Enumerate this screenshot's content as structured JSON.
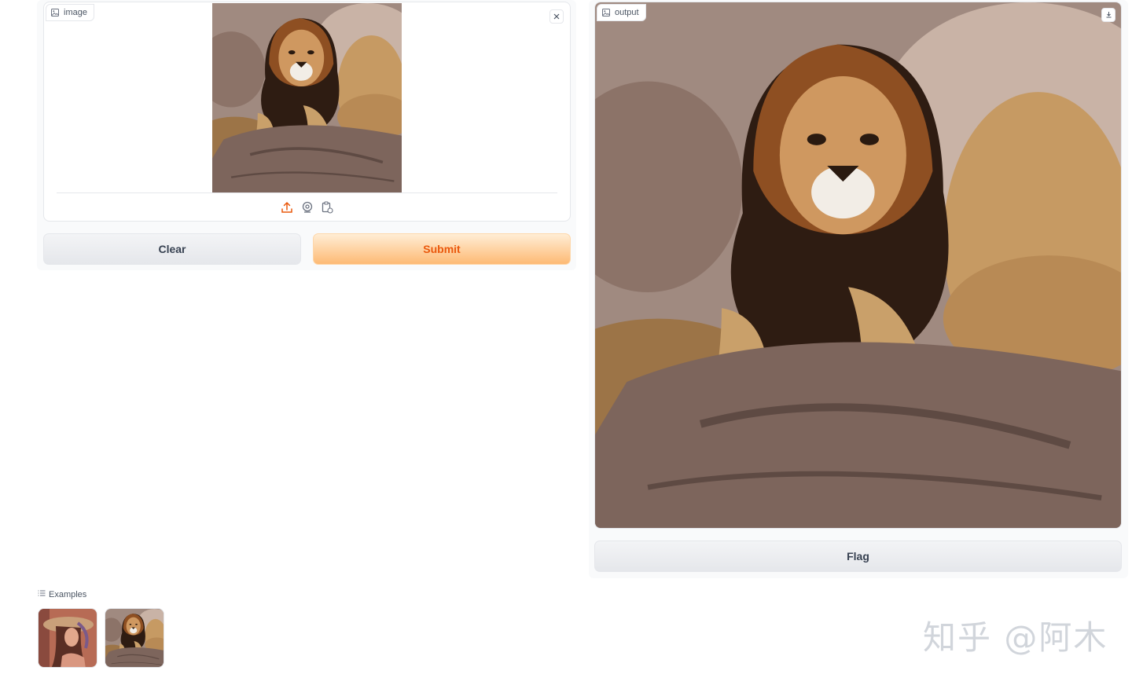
{
  "input_panel": {
    "label": "image",
    "label_icon": "image-icon",
    "clear_icon": "close-icon",
    "sources": [
      {
        "name": "upload-icon"
      },
      {
        "name": "webcam-icon"
      },
      {
        "name": "clipboard-icon"
      }
    ],
    "clear_button": "Clear",
    "submit_button": "Submit"
  },
  "output_panel": {
    "label": "output",
    "label_icon": "image-icon",
    "download_icon": "download-icon",
    "flag_button": "Flag"
  },
  "examples": {
    "label": "Examples",
    "label_icon": "list-icon",
    "items": [
      {
        "name": "woman-in-hat-thumbnail"
      },
      {
        "name": "lion-on-rock-thumbnail"
      }
    ]
  },
  "watermark": "知乎 @阿木",
  "colors": {
    "accent": "#ea580c",
    "primary_gradient_top": "#ffedd5",
    "primary_gradient_bottom": "#fdba74"
  }
}
